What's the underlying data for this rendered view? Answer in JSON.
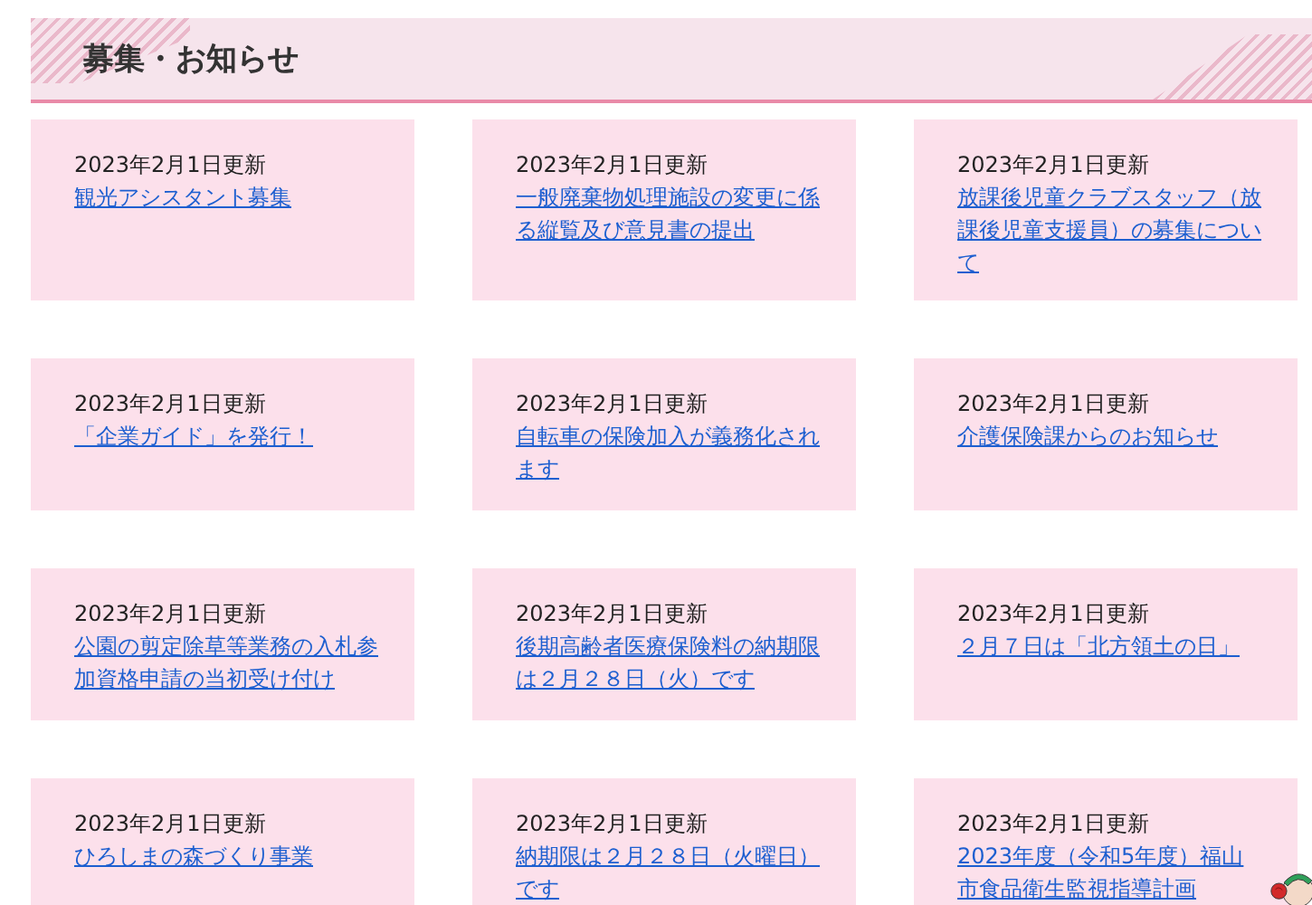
{
  "section": {
    "title": "募集・お知らせ"
  },
  "items": [
    {
      "date": "2023年2月1日更新",
      "title": "観光アシスタント募集"
    },
    {
      "date": "2023年2月1日更新",
      "title": "一般廃棄物処理施設の変更に係る縦覧及び意見書の提出"
    },
    {
      "date": "2023年2月1日更新",
      "title": "放課後児童クラブスタッフ（放課後児童支援員）の募集について"
    },
    {
      "date": "2023年2月1日更新",
      "title": "「企業ガイド」を発行！"
    },
    {
      "date": "2023年2月1日更新",
      "title": "自転車の保険加入が義務化されます"
    },
    {
      "date": "2023年2月1日更新",
      "title": "介護保険課からのお知らせ"
    },
    {
      "date": "2023年2月1日更新",
      "title": "公園の剪定除草等業務の入札参加資格申請の当初受け付け"
    },
    {
      "date": "2023年2月1日更新",
      "title": "後期高齢者医療保険料の納期限は２月２８日（火）です"
    },
    {
      "date": "2023年2月1日更新",
      "title": "２月７日は「北方領土の日」"
    },
    {
      "date": "2023年2月1日更新",
      "title": "ひろしまの森づくり事業"
    },
    {
      "date": "2023年2月1日更新",
      "title": "納期限は２月２８日（火曜日）です"
    },
    {
      "date": "2023年2月1日更新",
      "title": "2023年度（令和5年度）福山市食品衛生監視指導計画"
    }
  ]
}
